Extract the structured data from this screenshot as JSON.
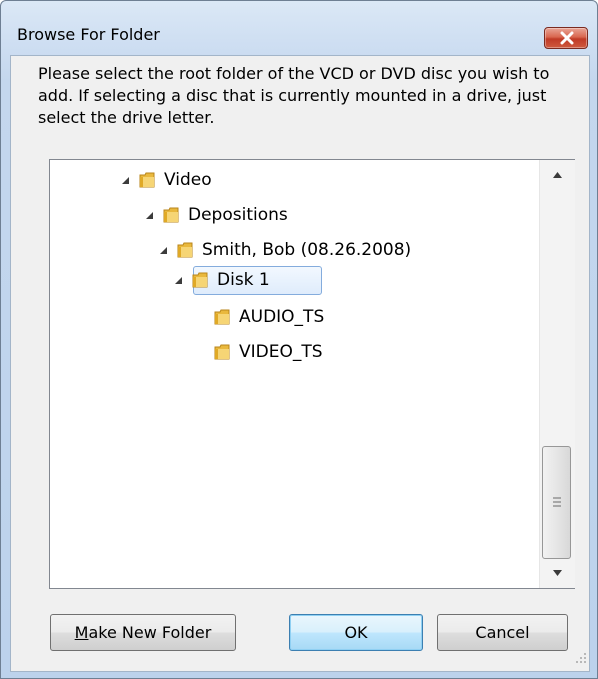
{
  "window": {
    "title": "Browse For Folder"
  },
  "instruction": "Please select the root folder of the VCD or DVD disc you wish to add.  If selecting a disc that is currently mounted in a drive, just select the drive letter.",
  "tree": {
    "items": [
      {
        "label": "Video",
        "expanded": true
      },
      {
        "label": "Depositions",
        "expanded": true
      },
      {
        "label": "Smith, Bob (08.26.2008)",
        "expanded": true
      },
      {
        "label": "Disk 1",
        "expanded": true,
        "selected": true
      },
      {
        "label": "AUDIO_TS",
        "expanded": false
      },
      {
        "label": "VIDEO_TS",
        "expanded": false
      }
    ]
  },
  "buttons": {
    "make_new_folder_mnemonic": "M",
    "make_new_folder_rest": "ake New Folder",
    "ok": "OK",
    "cancel": "Cancel"
  },
  "colors": {
    "folder": "#e8b73a",
    "close_button": "#c8452f",
    "selection_border": "#84acdd",
    "default_button_border": "#3c7fb1"
  },
  "icons": [
    "close-icon",
    "folder-icon",
    "expanded-arrow-icon",
    "scroll-up-icon",
    "scroll-down-icon",
    "scroll-grip-icon",
    "resize-grip-icon"
  ]
}
